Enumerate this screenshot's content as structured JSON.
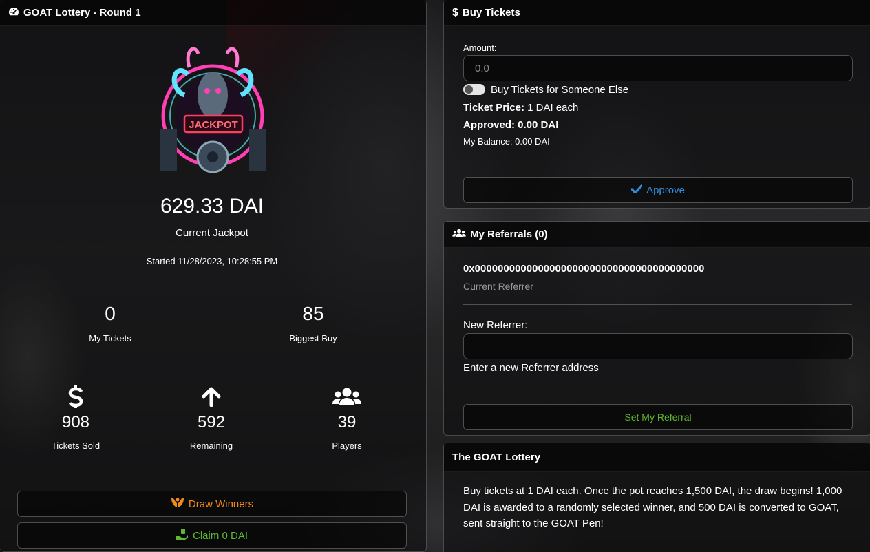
{
  "lottery": {
    "title": "GOAT Lottery - Round 1",
    "jackpot_amount": "629.33 DAI",
    "jackpot_label": "Current Jackpot",
    "started": "Started 11/28/2023, 10:28:55 PM",
    "logo_text": "JACKPOT",
    "stats": {
      "my_tickets": {
        "value": "0",
        "label": "My Tickets"
      },
      "biggest_buy": {
        "value": "85",
        "label": "Biggest Buy"
      },
      "tickets_sold": {
        "value": "908",
        "label": "Tickets Sold",
        "icon": "dollar-icon"
      },
      "remaining": {
        "value": "592",
        "label": "Remaining",
        "icon": "arrow-up-icon"
      },
      "players": {
        "value": "39",
        "label": "Players",
        "icon": "users-icon"
      }
    },
    "draw_button": "Draw Winners",
    "claim_button": "Claim 0 DAI"
  },
  "buy": {
    "title": "Buy Tickets",
    "amount_label": "Amount:",
    "amount_placeholder": "0.0",
    "toggle_label": "Buy Tickets for Someone Else",
    "toggle_on": false,
    "ticket_price_label": "Ticket Price:",
    "ticket_price_value": "1 DAI each",
    "approved": "Approved: 0.00 DAI",
    "balance": "My Balance: 0.00 DAI",
    "approve_button": "Approve"
  },
  "referrals": {
    "title": "My Referrals (0)",
    "current_referrer": "0x0000000000000000000000000000000000000000",
    "current_referrer_label": "Current Referrer",
    "new_referrer_label": "New Referrer:",
    "new_referrer_value": "",
    "hint": "Enter a new Referrer address",
    "set_button": "Set My Referral"
  },
  "about": {
    "title": "The GOAT Lottery",
    "text": "Buy tickets at 1 DAI each. Once the pot reaches 1,500 DAI, the draw begins! 1,000 DAI is awarded to a randomly selected winner, and 500 DAI is converted to GOAT, sent straight to the GOAT Pen!"
  },
  "colors": {
    "accent_blue": "#2f8fdf",
    "accent_orange": "#f08a1c",
    "accent_green": "#5fb82f",
    "neon_pink": "#ff3fb4",
    "neon_cyan": "#5fe3ff"
  }
}
